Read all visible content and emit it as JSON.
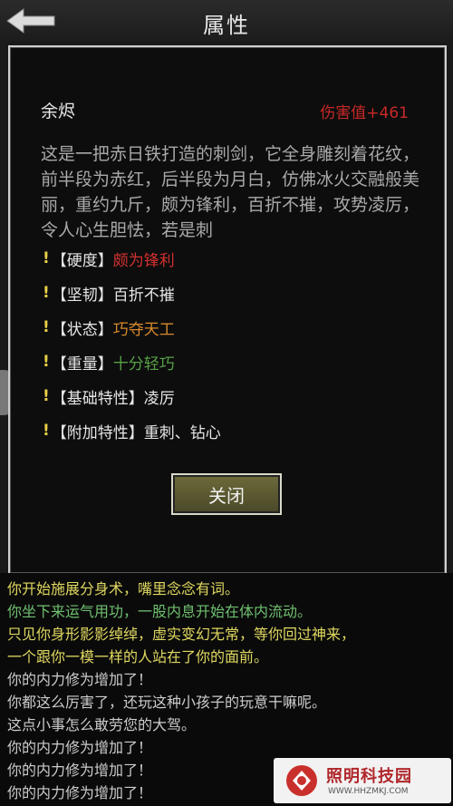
{
  "header": {
    "title": "属性"
  },
  "item": {
    "name": "余烬",
    "damage": "伤害值+461",
    "description": "这是一把赤日铁打造的刺剑，它全身雕刻着花纹，前半段为赤红，后半段为月白，仿佛冰火交融般美丽，重约九斤，颇为锋利，百折不摧，攻势凌厉，令人心生胆怯，若是刺"
  },
  "properties": [
    {
      "mark": "!",
      "key": "【硬度】",
      "value": "颇为锋利",
      "color": "#d23030"
    },
    {
      "mark": "!",
      "key": "【坚韧】",
      "value": "百折不摧",
      "color": "#e6e6e6"
    },
    {
      "mark": "!",
      "key": "【状态】",
      "value": "巧夺天工",
      "color": "#d88a2c"
    },
    {
      "mark": "!",
      "key": "【重量】",
      "value": "十分轻巧",
      "color": "#56a046"
    },
    {
      "mark": "!",
      "key": "【基础特性】",
      "value": "凌厉",
      "color": "#e6e6e6"
    },
    {
      "mark": "!",
      "key": "【附加特性】",
      "value": "重刺、钻心",
      "color": "#e6e6e6"
    }
  ],
  "close_label": "关闭",
  "log": [
    {
      "text": "你开始施展分身术，嘴里念念有词。",
      "color": "#e0d860"
    },
    {
      "text": "你坐下来运气用功，一股内息开始在体内流动。",
      "color": "#70c070"
    },
    {
      "text": "只见你身形影影绰绰，虚实变幻无常，等你回过神来，",
      "color": "#e0d860"
    },
    {
      "text": "一个跟你一模一样的人站在了你的面前。",
      "color": "#e0d860"
    },
    {
      "text": "你的内力修为增加了！",
      "color": "#cccccc"
    },
    {
      "text": "你都这么厉害了，还玩这种小孩子的玩意干嘛呢。",
      "color": "#cccccc"
    },
    {
      "text": "这点小事怎么敢劳您的大驾。",
      "color": "#cccccc"
    },
    {
      "text": "你的内力修为增加了！",
      "color": "#cccccc"
    },
    {
      "text": "你的内力修为增加了！",
      "color": "#cccccc"
    },
    {
      "text": "你的内力修为增加了！",
      "color": "#cccccc"
    }
  ],
  "watermark": {
    "title": "照明科技园",
    "url": "WWW.HHZMKJ.COM"
  }
}
